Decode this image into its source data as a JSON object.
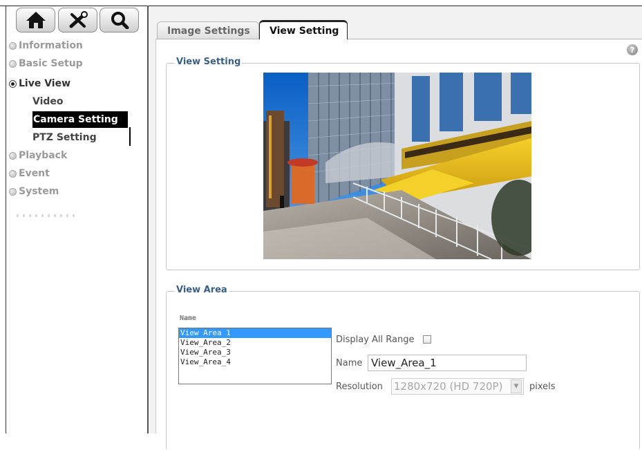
{
  "toolbar": {
    "icons": [
      "home-icon",
      "tools-icon",
      "search-icon"
    ]
  },
  "sidebar": {
    "items": [
      {
        "label": "Information",
        "state": "collapsed"
      },
      {
        "label": "Basic Setup",
        "state": "collapsed"
      },
      {
        "label": "Live View",
        "state": "expanded"
      },
      {
        "label": "Playback",
        "state": "collapsed"
      },
      {
        "label": "Event",
        "state": "collapsed"
      },
      {
        "label": "System",
        "state": "collapsed"
      }
    ],
    "live_view_children": [
      {
        "label": "Video"
      },
      {
        "label": "Camera Setting",
        "selected": true
      },
      {
        "label": "PTZ Setting"
      }
    ]
  },
  "tabs": [
    {
      "label": "Image Settings",
      "active": false
    },
    {
      "label": "View Setting",
      "active": true
    }
  ],
  "view_setting": {
    "legend": "View Setting",
    "preview_scene": "camera-preview-street-scene"
  },
  "view_area": {
    "legend": "View Area",
    "name_caption": "Name",
    "list_items": [
      "View Area 1",
      "View_Area_2",
      "View_Area_3",
      "View_Area_4"
    ],
    "selected_index": 0,
    "display_all_range_label": "Display All Range",
    "display_all_range_checked": false,
    "name_label": "Name",
    "name_value": "View_Area_1",
    "resolution_label": "Resolution",
    "resolution_value": "1280x720 (HD 720P)",
    "resolution_unit": "pixels"
  },
  "colors": {
    "accent": "#3a5e84",
    "selection": "#3399ff",
    "sidebar_selected_bg": "#000000",
    "panel_bg": "#f2f2f2"
  }
}
